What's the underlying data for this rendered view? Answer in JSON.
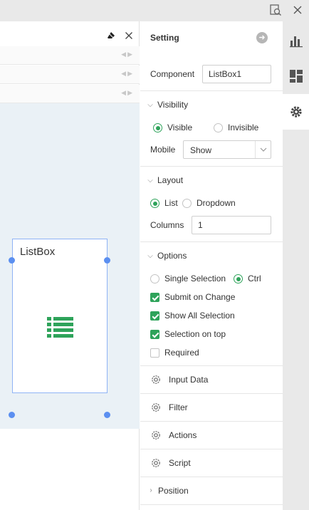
{
  "settings": {
    "title": "Setting",
    "component_label": "Component",
    "component_value": "ListBox1",
    "visibility": {
      "header": "Visibility",
      "visible_label": "Visible",
      "invisible_label": "Invisible",
      "selected": "Visible",
      "mobile_label": "Mobile",
      "mobile_value": "Show"
    },
    "layout": {
      "header": "Layout",
      "list_label": "List",
      "dropdown_label": "Dropdown",
      "selected": "List",
      "columns_label": "Columns",
      "columns_value": "1"
    },
    "options": {
      "header": "Options",
      "single_label": "Single Selection",
      "ctrl_label": "Ctrl",
      "selected_mode": "Ctrl",
      "submit_label": "Submit on Change",
      "submit_checked": true,
      "show_all_label": "Show All Selection",
      "show_all_checked": true,
      "sel_top_label": "Selection on top",
      "sel_top_checked": true,
      "required_label": "Required",
      "required_checked": false
    },
    "sections": {
      "input_data": "Input Data",
      "filter": "Filter",
      "actions": "Actions",
      "script": "Script",
      "position": "Position"
    }
  },
  "canvas": {
    "component_title": "ListBox"
  },
  "colors": {
    "accent_green": "#2ea35a",
    "selection_blue": "#5b8ff0",
    "canvas_bg": "#eaf1f6"
  }
}
